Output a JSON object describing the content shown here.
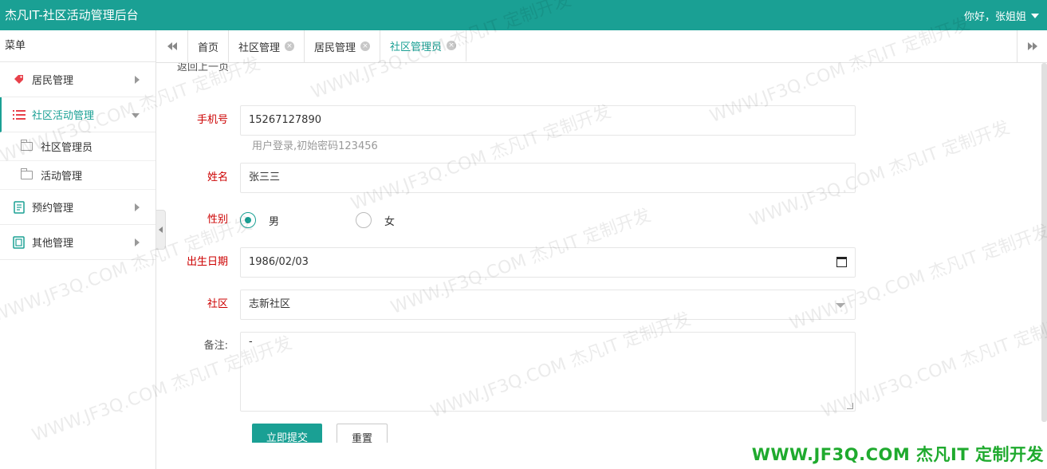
{
  "header": {
    "title": "杰凡IT-社区活动管理后台",
    "user": "你好，张姐姐"
  },
  "sidebar": {
    "heading": "菜单",
    "items": [
      {
        "label": "居民管理",
        "icon": "tag-icon"
      },
      {
        "label": "社区活动管理",
        "icon": "list-icon",
        "active": true,
        "children": [
          {
            "label": "社区管理员"
          },
          {
            "label": "活动管理"
          }
        ]
      },
      {
        "label": "预约管理",
        "icon": "document-icon"
      },
      {
        "label": "其他管理",
        "icon": "notes-icon"
      }
    ]
  },
  "tabs": [
    {
      "label": "首页",
      "closable": false
    },
    {
      "label": "社区管理",
      "closable": true
    },
    {
      "label": "居民管理",
      "closable": true
    },
    {
      "label": "社区管理员",
      "closable": true,
      "active": true
    }
  ],
  "form": {
    "section_title": "返回上一页",
    "phone": {
      "label": "手机号",
      "value": "15267127890",
      "hint": "用户登录,初始密码123456"
    },
    "name": {
      "label": "姓名",
      "value": "张三三"
    },
    "gender": {
      "label": "性别",
      "options": [
        "男",
        "女"
      ],
      "selected": "男"
    },
    "birthday": {
      "label": "出生日期",
      "value": "1986/02/03"
    },
    "community": {
      "label": "社区",
      "value": "志新社区"
    },
    "remark": {
      "label": "备注:",
      "value": "-"
    },
    "submit_label": "立即提交",
    "reset_label": "重置"
  },
  "watermark": {
    "text": "WWW.JF3Q.COM 杰凡IT 定制开发",
    "color": "#1faa2e"
  },
  "colors": {
    "accent": "#1aa094",
    "required_label": "#cc0000"
  }
}
